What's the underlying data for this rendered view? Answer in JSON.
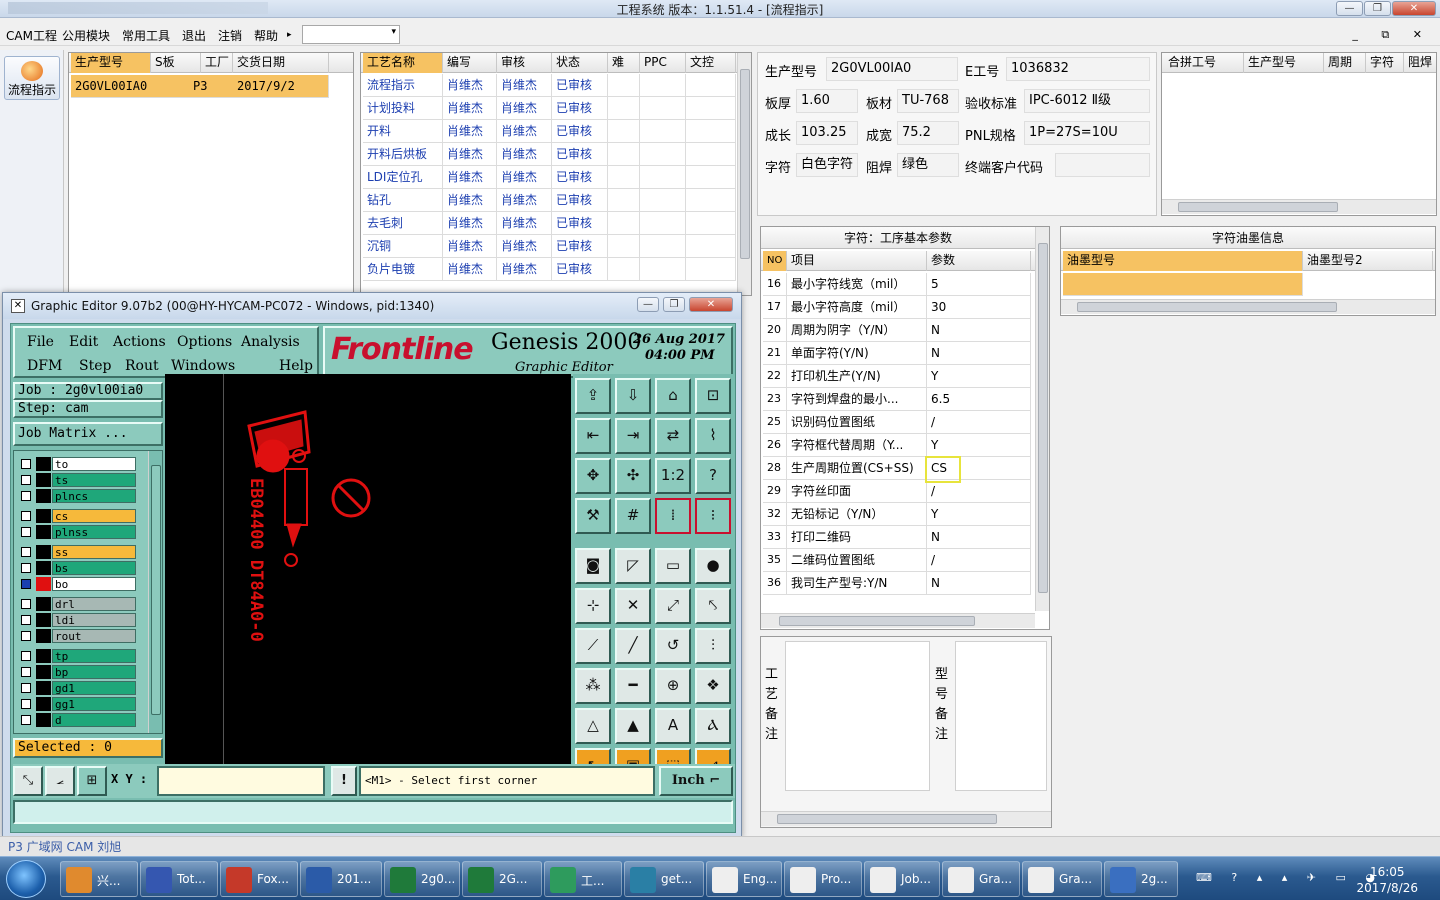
{
  "window": {
    "title": "工程系统   版本：1.1.51.4 - [流程指示]"
  },
  "menu": {
    "items": [
      "CAM工程",
      "公用模块",
      "常用工具",
      "退出",
      "注销",
      "帮助"
    ],
    "help_arrow": "▸",
    "mdi_controls": "_ ⧉ ✕"
  },
  "leftnav": {
    "button_label": "流程指示"
  },
  "jobs_grid": {
    "headers": [
      "生产型号",
      "S板",
      "工厂",
      "交货日期"
    ],
    "rows": [
      [
        "2G0VL00IA0",
        "",
        "P3",
        "2017/9/2"
      ]
    ]
  },
  "process_grid": {
    "headers": [
      "工艺名称",
      "编写",
      "审核",
      "状态",
      "难",
      "PPC",
      "文控"
    ],
    "rows": [
      [
        "流程指示",
        "肖维杰",
        "肖维杰",
        "已审核"
      ],
      [
        "计划投料",
        "肖维杰",
        "肖维杰",
        "已审核"
      ],
      [
        "开料",
        "肖维杰",
        "肖维杰",
        "已审核"
      ],
      [
        "开料后烘板",
        "肖维杰",
        "肖维杰",
        "已审核"
      ],
      [
        "LDI定位孔",
        "肖维杰",
        "肖维杰",
        "已审核"
      ],
      [
        "钻孔",
        "肖维杰",
        "肖维杰",
        "已审核"
      ],
      [
        "去毛刺",
        "肖维杰",
        "肖维杰",
        "已审核"
      ],
      [
        "沉铜",
        "肖维杰",
        "肖维杰",
        "已审核"
      ],
      [
        "负片电镀",
        "肖维杰",
        "肖维杰",
        "已审核"
      ]
    ]
  },
  "info": {
    "prod_model_label": "生产型号",
    "prod_model": "2G0VL00IA0",
    "e_label": "E工号",
    "e_value": "1036832",
    "thick_label": "板厚",
    "thick": "1.60",
    "mat_label": "板材",
    "mat": "TU-768",
    "std_label": "验收标准",
    "std": "IPC-6012 Ⅱ级",
    "len_label": "成长",
    "len": "103.25",
    "wid_label": "成宽",
    "wid": "75.2",
    "pnl_label": "PNL规格",
    "pnl": "1P=27S=10U",
    "char_label": "字符",
    "char": "白色字符",
    "mask_label": "阻焊",
    "mask": "绿色",
    "cust_label": "终端客户代码",
    "cust": ""
  },
  "merge_grid": {
    "headers": [
      "合拼工号",
      "生产型号",
      "周期",
      "字符",
      "阻焊"
    ]
  },
  "params": {
    "title": "字符：工序基本参数",
    "headers": [
      "NO",
      "项目",
      "参数"
    ],
    "rows": [
      [
        "16",
        "最小字符线宽（mil）",
        "5"
      ],
      [
        "17",
        "最小字符高度（mil）",
        "30"
      ],
      [
        "20",
        "周期为阴字（Y/N）",
        "N"
      ],
      [
        "21",
        "单面字符(Y/N)",
        "N"
      ],
      [
        "22",
        "打印机生产(Y/N)",
        "Y"
      ],
      [
        "23",
        "字符到焊盘的最小...",
        "6.5"
      ],
      [
        "25",
        "识别码位置图纸",
        "/"
      ],
      [
        "26",
        "字符框代替周期（Y...",
        "Y"
      ],
      [
        "28",
        "生产周期位置(CS+SS)",
        "CS"
      ],
      [
        "29",
        "字符丝印面",
        "/"
      ],
      [
        "32",
        "无铅标记（Y/N）",
        "Y"
      ],
      [
        "33",
        "打印二维码",
        "N"
      ],
      [
        "35",
        "二维码位置图纸",
        "/"
      ],
      [
        "36",
        "我司生产型号:Y/N",
        "N"
      ]
    ]
  },
  "ink": {
    "title": "字符油墨信息",
    "headers": [
      "油墨型号",
      "油墨型号2"
    ]
  },
  "notes": {
    "process_label": "工艺备注",
    "model_label": "型号备注"
  },
  "editor": {
    "title": "Graphic Editor 9.07b2 (00@HY-HYCAM-PC072 - Windows, pid:1340)",
    "menu_row1": [
      "File",
      "Edit",
      "Actions",
      "Options",
      "Analysis"
    ],
    "menu_row2": [
      "DFM",
      "Step",
      "Rout",
      "Windows",
      "Help"
    ],
    "brand": "Frontline",
    "product": "Genesis 2000",
    "subtitle": "Graphic Editor",
    "date": "26 Aug 2017",
    "time": "04:00 PM",
    "job": "Job  : 2g0vl00ia0",
    "step": "Step: cam",
    "job_matrix": "Job Matrix ...",
    "layers": [
      {
        "name": "to",
        "color": "#ffffff"
      },
      {
        "name": "ts",
        "color": "#1fa77a"
      },
      {
        "name": "plncs",
        "color": "#1fa77a"
      },
      {
        "name": "cs",
        "color": "#f6b93b"
      },
      {
        "name": "plnss",
        "color": "#1fa77a"
      },
      {
        "name": "ss",
        "color": "#f6b93b"
      },
      {
        "name": "bs",
        "color": "#1fa77a"
      },
      {
        "name": "bo",
        "color": "#ffffff"
      },
      {
        "name": "drl",
        "color": "#a7b8b4"
      },
      {
        "name": "ldi",
        "color": "#a7b8b4"
      },
      {
        "name": "rout",
        "color": "#a7b8b4"
      },
      {
        "name": "tp",
        "color": "#1fa77a"
      },
      {
        "name": "bp",
        "color": "#1fa77a"
      },
      {
        "name": "gd1",
        "color": "#1fa77a"
      },
      {
        "name": "gg1",
        "color": "#1fa77a"
      },
      {
        "name": "d",
        "color": "#1fa77a"
      }
    ],
    "selected": "Selected : 0",
    "xy_label": "X Y :",
    "prompt": "<M1> - Select first corner",
    "units": "Inch",
    "board_text": "EB04400 DT84A0-0"
  },
  "statusline": {
    "text": "P3    广域网    CAM    刘旭"
  },
  "taskbar": {
    "items": [
      "兴...",
      "Tot...",
      "Fox...",
      "201...",
      "2g0...",
      "2G...",
      "工...",
      "get...",
      "Eng...",
      "Pro...",
      "Job...",
      "Gra...",
      "Gra...",
      "2g..."
    ],
    "time": "16:05",
    "date": "2017/8/26"
  },
  "colors": {
    "accent_orange": "#f6c262",
    "link_blue": "#1d3fb0",
    "highlight_yellow": "#e7e43c",
    "pcb_red": "#e01010"
  }
}
